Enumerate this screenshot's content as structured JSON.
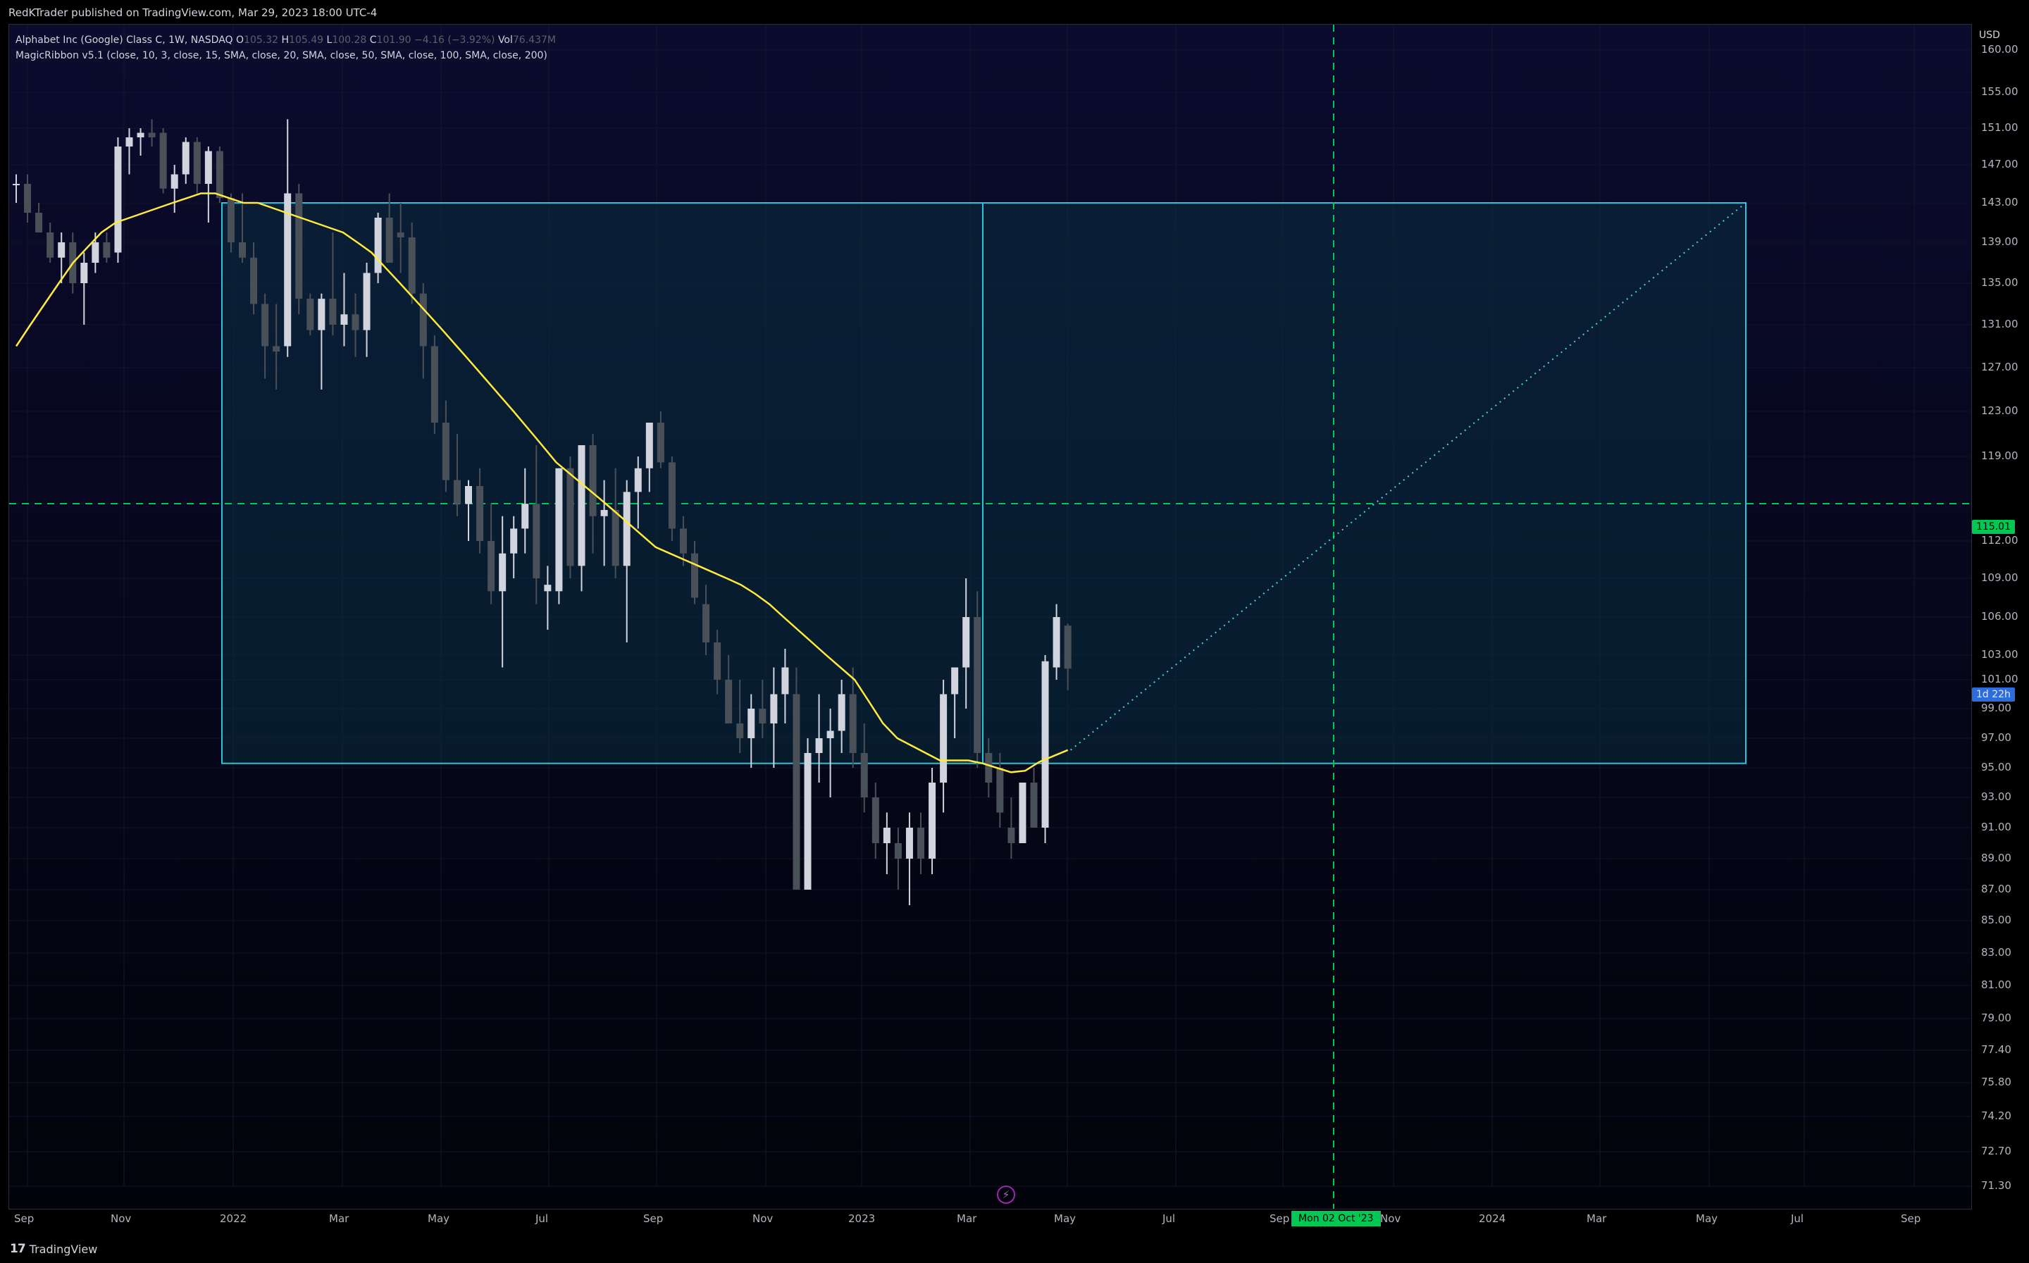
{
  "header": {
    "published_text": "RedKTrader published on TradingView.com, Mar 29, 2023 18:00 UTC-4"
  },
  "legend": {
    "symbol": "Alphabet Inc (Google) Class C, 1W, NASDAQ",
    "open_label": "O",
    "open_value": "105.32",
    "high_label": "H",
    "high_value": "105.49",
    "low_label": "L",
    "low_value": "100.28",
    "close_label": "C",
    "close_value": "101.90",
    "change": "−4.16 (−3.92%)",
    "vol_label": "Vol",
    "vol_value": "76.437M",
    "indicator": "MagicRibbon v5.1 (close, 10, 3, close, 15, SMA, close, 20, SMA, close, 50, SMA, close, 100, SMA, close, 200)"
  },
  "price_axis": {
    "currency": "USD",
    "ticks": [
      "160.00",
      "155.00",
      "151.00",
      "147.00",
      "143.00",
      "139.00",
      "135.00",
      "131.00",
      "127.00",
      "123.00",
      "119.00",
      "115.01",
      "112.00",
      "109.00",
      "106.00",
      "103.00",
      "101.00",
      "99.00",
      "97.00",
      "95.00",
      "93.00",
      "91.00",
      "89.00",
      "87.00",
      "85.00",
      "83.00",
      "81.00",
      "79.00",
      "77.40",
      "75.80",
      "74.20",
      "72.70",
      "71.30"
    ],
    "highlight_value": "115.01",
    "countdown": "1d 22h"
  },
  "time_axis": {
    "labels": [
      "Sep",
      "Nov",
      "2022",
      "Mar",
      "May",
      "Jul",
      "Sep",
      "Nov",
      "2023",
      "Mar",
      "May",
      "Jul",
      "Sep",
      "Nov",
      "2024",
      "Mar",
      "May",
      "Jul",
      "Sep"
    ],
    "crosshair_date": "Mon 02 Oct '23"
  },
  "footer": {
    "brand": "TradingView"
  },
  "colors": {
    "background": "#000000",
    "up_candle": "#d1d4dc",
    "down_candle": "#4a5058",
    "ma_line": "#ffeb3b",
    "box_border": "#26c6da",
    "box_fill": "#0d2a3a",
    "crosshair": "#00c853"
  },
  "chart_data": {
    "type": "candlestick",
    "interval": "1W",
    "ylim": [
      70,
      165
    ],
    "ohlc": [
      {
        "o": 145,
        "h": 146,
        "l": 143,
        "c": 145
      },
      {
        "o": 145,
        "h": 146,
        "l": 141,
        "c": 142
      },
      {
        "o": 142,
        "h": 143,
        "l": 140,
        "c": 140
      },
      {
        "o": 140,
        "h": 141,
        "l": 137,
        "c": 137.5
      },
      {
        "o": 137.5,
        "h": 140,
        "l": 135,
        "c": 139
      },
      {
        "o": 139,
        "h": 140,
        "l": 134,
        "c": 135
      },
      {
        "o": 135,
        "h": 138,
        "l": 131,
        "c": 137
      },
      {
        "o": 137,
        "h": 140,
        "l": 136,
        "c": 139
      },
      {
        "o": 139,
        "h": 140,
        "l": 137,
        "c": 137.5
      },
      {
        "o": 138,
        "h": 150,
        "l": 137,
        "c": 149
      },
      {
        "o": 149,
        "h": 151,
        "l": 146,
        "c": 150
      },
      {
        "o": 150,
        "h": 151,
        "l": 148,
        "c": 150.5
      },
      {
        "o": 150.5,
        "h": 152,
        "l": 149,
        "c": 150
      },
      {
        "o": 150.5,
        "h": 151,
        "l": 144,
        "c": 144.5
      },
      {
        "o": 144.5,
        "h": 147,
        "l": 142,
        "c": 146
      },
      {
        "o": 146,
        "h": 150,
        "l": 145,
        "c": 149.5
      },
      {
        "o": 149.5,
        "h": 150,
        "l": 144,
        "c": 145
      },
      {
        "o": 145,
        "h": 149,
        "l": 141,
        "c": 148.5
      },
      {
        "o": 148.5,
        "h": 149,
        "l": 143,
        "c": 143.5
      },
      {
        "o": 143.5,
        "h": 144,
        "l": 138,
        "c": 139
      },
      {
        "o": 139,
        "h": 144,
        "l": 137,
        "c": 137.5
      },
      {
        "o": 137.5,
        "h": 139,
        "l": 132,
        "c": 133
      },
      {
        "o": 133,
        "h": 134,
        "l": 126,
        "c": 129
      },
      {
        "o": 129,
        "h": 133,
        "l": 125,
        "c": 128.5
      },
      {
        "o": 129,
        "h": 152,
        "l": 128,
        "c": 144
      },
      {
        "o": 144,
        "h": 145,
        "l": 132,
        "c": 133.5
      },
      {
        "o": 133.5,
        "h": 134,
        "l": 130,
        "c": 130.5
      },
      {
        "o": 130.5,
        "h": 134,
        "l": 125,
        "c": 133.5
      },
      {
        "o": 133.5,
        "h": 140,
        "l": 130,
        "c": 131
      },
      {
        "o": 131,
        "h": 136,
        "l": 129,
        "c": 132
      },
      {
        "o": 132,
        "h": 134,
        "l": 128,
        "c": 130.5
      },
      {
        "o": 130.5,
        "h": 137,
        "l": 128,
        "c": 136
      },
      {
        "o": 136,
        "h": 142,
        "l": 135,
        "c": 141.5
      },
      {
        "o": 141.5,
        "h": 144,
        "l": 139,
        "c": 137
      },
      {
        "o": 140,
        "h": 143,
        "l": 136,
        "c": 139.5
      },
      {
        "o": 139.5,
        "h": 141,
        "l": 133,
        "c": 134
      },
      {
        "o": 134,
        "h": 135,
        "l": 126,
        "c": 129
      },
      {
        "o": 129,
        "h": 130,
        "l": 121,
        "c": 122
      },
      {
        "o": 122,
        "h": 124,
        "l": 116,
        "c": 117
      },
      {
        "o": 117,
        "h": 121,
        "l": 114,
        "c": 115
      },
      {
        "o": 115,
        "h": 117,
        "l": 112,
        "c": 116.5
      },
      {
        "o": 116.5,
        "h": 118,
        "l": 111,
        "c": 112
      },
      {
        "o": 112,
        "h": 115,
        "l": 107,
        "c": 108
      },
      {
        "o": 108,
        "h": 114,
        "l": 102,
        "c": 111
      },
      {
        "o": 111,
        "h": 114,
        "l": 109,
        "c": 113
      },
      {
        "o": 113,
        "h": 118,
        "l": 111,
        "c": 115
      },
      {
        "o": 115,
        "h": 120,
        "l": 107,
        "c": 109
      },
      {
        "o": 108,
        "h": 110,
        "l": 105,
        "c": 108.5
      },
      {
        "o": 108,
        "h": 118,
        "l": 107,
        "c": 118
      },
      {
        "o": 118,
        "h": 119,
        "l": 109,
        "c": 110
      },
      {
        "o": 110,
        "h": 120,
        "l": 108,
        "c": 120
      },
      {
        "o": 120,
        "h": 121,
        "l": 111,
        "c": 114
      },
      {
        "o": 114,
        "h": 117,
        "l": 110,
        "c": 114.5
      },
      {
        "o": 114.5,
        "h": 118,
        "l": 109,
        "c": 110
      },
      {
        "o": 110,
        "h": 117,
        "l": 104,
        "c": 116
      },
      {
        "o": 116,
        "h": 119,
        "l": 113,
        "c": 118
      },
      {
        "o": 118,
        "h": 122,
        "l": 116,
        "c": 122
      },
      {
        "o": 122,
        "h": 123,
        "l": 118,
        "c": 118.5
      },
      {
        "o": 118.5,
        "h": 119,
        "l": 112,
        "c": 113
      },
      {
        "o": 113,
        "h": 114,
        "l": 110,
        "c": 111
      },
      {
        "o": 111,
        "h": 112,
        "l": 107,
        "c": 107.5
      },
      {
        "o": 107,
        "h": 108.5,
        "l": 103,
        "c": 104
      },
      {
        "o": 104,
        "h": 105,
        "l": 100,
        "c": 101
      },
      {
        "o": 101,
        "h": 103,
        "l": 98,
        "c": 98
      },
      {
        "o": 98,
        "h": 101,
        "l": 96,
        "c": 97
      },
      {
        "o": 97,
        "h": 100,
        "l": 95,
        "c": 99
      },
      {
        "o": 99,
        "h": 101,
        "l": 97,
        "c": 98
      },
      {
        "o": 98,
        "h": 102,
        "l": 95,
        "c": 100
      },
      {
        "o": 100,
        "h": 103.5,
        "l": 98,
        "c": 102
      },
      {
        "o": 100,
        "h": 102,
        "l": 88,
        "c": 87
      },
      {
        "o": 87,
        "h": 97,
        "l": 87,
        "c": 96
      },
      {
        "o": 96,
        "h": 100,
        "l": 94,
        "c": 97
      },
      {
        "o": 97,
        "h": 99,
        "l": 93,
        "c": 97.5
      },
      {
        "o": 97.5,
        "h": 101,
        "l": 96,
        "c": 100
      },
      {
        "o": 100,
        "h": 102,
        "l": 95,
        "c": 96
      },
      {
        "o": 96,
        "h": 98,
        "l": 92,
        "c": 93
      },
      {
        "o": 93,
        "h": 94,
        "l": 89,
        "c": 90
      },
      {
        "o": 90,
        "h": 92,
        "l": 88,
        "c": 91
      },
      {
        "o": 90,
        "h": 91,
        "l": 87,
        "c": 89
      },
      {
        "o": 89,
        "h": 92,
        "l": 86,
        "c": 91
      },
      {
        "o": 91,
        "h": 92,
        "l": 88,
        "c": 89
      },
      {
        "o": 89,
        "h": 95,
        "l": 88,
        "c": 94
      },
      {
        "o": 94,
        "h": 101,
        "l": 92,
        "c": 100
      },
      {
        "o": 100,
        "h": 102,
        "l": 97,
        "c": 102
      },
      {
        "o": 102,
        "h": 109,
        "l": 99,
        "c": 106
      },
      {
        "o": 106,
        "h": 108,
        "l": 95,
        "c": 96
      },
      {
        "o": 96,
        "h": 97,
        "l": 93,
        "c": 94
      },
      {
        "o": 95,
        "h": 96,
        "l": 91,
        "c": 92
      },
      {
        "o": 91,
        "h": 93,
        "l": 89,
        "c": 90
      },
      {
        "o": 90,
        "h": 94,
        "l": 90,
        "c": 94
      },
      {
        "o": 94,
        "h": 95,
        "l": 91,
        "c": 91
      },
      {
        "o": 91,
        "h": 103,
        "l": 90,
        "c": 102.5
      },
      {
        "o": 102,
        "h": 107,
        "l": 101,
        "c": 106
      },
      {
        "o": 105.32,
        "h": 105.49,
        "l": 100.28,
        "c": 101.9
      }
    ],
    "ma_line": [
      129,
      131,
      133,
      135,
      137,
      138.5,
      140,
      141,
      141.5,
      142,
      142.5,
      143,
      143.5,
      144,
      144,
      143.5,
      143,
      143,
      142.5,
      142,
      141.5,
      141,
      140.5,
      140,
      139,
      138,
      136.5,
      135,
      133.5,
      132,
      130.5,
      129,
      127.5,
      126,
      124.5,
      123,
      121.5,
      120,
      118.5,
      117.5,
      116.5,
      115.5,
      114.5,
      113.5,
      112.5,
      111.5,
      111,
      110.5,
      110,
      109.5,
      109,
      108.5,
      107.8,
      107,
      106,
      105,
      104,
      103,
      102,
      101,
      99.5,
      98,
      97,
      96.5,
      96,
      95.5,
      95.5,
      95.5,
      95.3,
      95,
      94.7,
      94.8,
      95.4,
      95.8,
      96.2
    ],
    "rectangle": {
      "top_price": 143,
      "bottom_price": 95.3,
      "start_bar": 24,
      "end_date": "2024-05"
    },
    "projection_line": {
      "from_price": 96.2,
      "to_price": 143
    },
    "crosshair": {
      "price": 115.01,
      "date": "Mon 02 Oct '23"
    }
  }
}
